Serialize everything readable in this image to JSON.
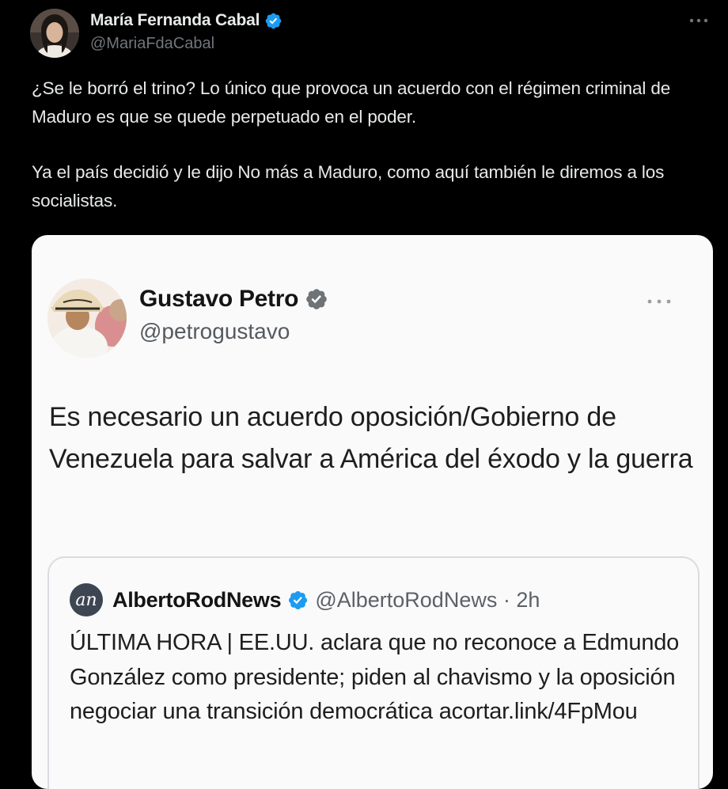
{
  "tweet": {
    "author": {
      "name": "María Fernanda Cabal",
      "handle": "@MariaFdaCabal"
    },
    "text": {
      "p1": "¿Se le borró el trino? Lo único que provoca un acuerdo con el régimen criminal de Maduro es que se quede perpetuado en el poder.",
      "p2": "Ya el país decidió y le dijo No más a Maduro, como aquí también le diremos a los socialistas."
    },
    "icons": {
      "verified": "verified-badge-icon",
      "more": "more-options-icon"
    },
    "colors": {
      "background": "#000000",
      "text": "#e7e9ea",
      "muted": "#71767b",
      "verified": "#1d9bf0"
    }
  },
  "embedded_screenshot": {
    "author": {
      "name": "Gustavo Petro",
      "handle": "@petrogustavo"
    },
    "text": "Es necesario un acuerdo oposición/Gobierno de Venezuela para salvar a América del éxodo y la guerra",
    "icons": {
      "verified": "verified-badge-gray-icon",
      "more": "more-options-icon"
    },
    "quoted": {
      "logo_text": "an",
      "name": "AlbertoRodNews",
      "handle_time": "@AlbertoRodNews · 2h",
      "text": "ÚLTIMA HORA | EE.UU. aclara que no reconoce a Edmundo González como presidente; piden al chavismo y la oposición negociar una transición democrática acortar.link/4FpMou"
    },
    "colors": {
      "card_background": "#fafafa",
      "gray_badge": "#6e7378",
      "blue_badge": "#1d9bf0"
    }
  }
}
